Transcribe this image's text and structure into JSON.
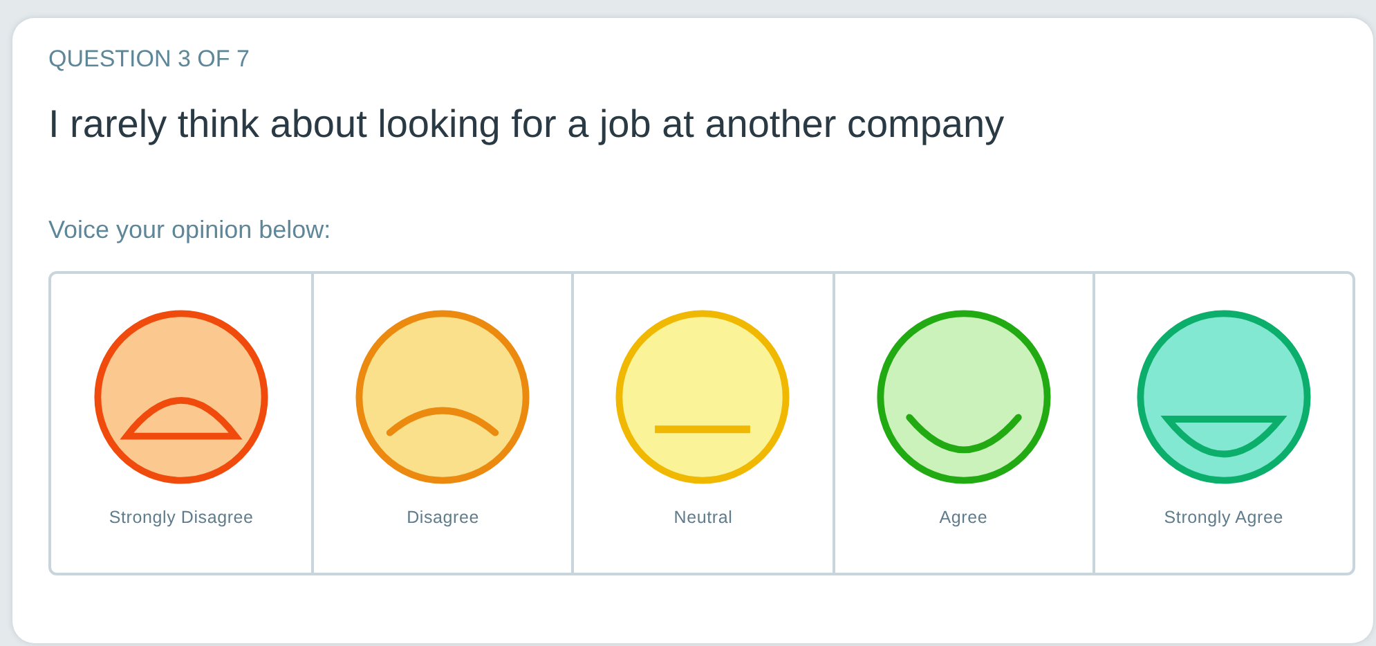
{
  "progress": "QUESTION 3 OF 7",
  "question": "I rarely think about looking for a job at another company",
  "prompt": "Voice your opinion below:",
  "options": [
    {
      "label": "Strongly Disagree",
      "kind": "strongly-negative",
      "color": "#f04a0c"
    },
    {
      "label": "Disagree",
      "kind": "negative",
      "color": "#ec8a10"
    },
    {
      "label": "Neutral",
      "kind": "neutral",
      "color": "#f0b800"
    },
    {
      "label": "Agree",
      "kind": "positive",
      "color": "#22aa12"
    },
    {
      "label": "Strongly Agree",
      "kind": "strongly-positive",
      "color": "#0bae6a"
    }
  ]
}
